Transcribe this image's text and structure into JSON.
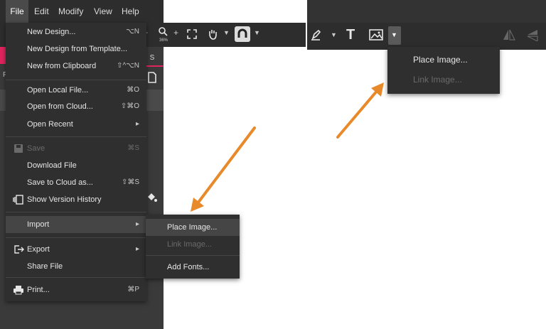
{
  "menubar": {
    "items": [
      "File",
      "Edit",
      "Modify",
      "View",
      "Help"
    ]
  },
  "toolbar": {
    "zoom_label": "36%"
  },
  "file_menu": {
    "items": [
      {
        "label": "New Design...",
        "shortcut": "⌥N",
        "disabled": false
      },
      {
        "label": "New Design from Template...",
        "shortcut": "",
        "disabled": false
      },
      {
        "label": "New from Clipboard",
        "shortcut": "⇧^⌥N",
        "disabled": false
      },
      {
        "label": "Open Local File...",
        "shortcut": "⌘O",
        "disabled": false
      },
      {
        "label": "Open from Cloud...",
        "shortcut": "⇧⌘O",
        "disabled": false
      },
      {
        "label": "Open Recent",
        "shortcut": "",
        "submenu": true,
        "disabled": false
      },
      {
        "label": "Save",
        "shortcut": "⌘S",
        "disabled": true
      },
      {
        "label": "Download File",
        "shortcut": "",
        "disabled": false
      },
      {
        "label": "Save to Cloud as...",
        "shortcut": "⇧⌘S",
        "disabled": false
      },
      {
        "label": "Show Version History",
        "shortcut": "",
        "disabled": false
      },
      {
        "label": "Import",
        "shortcut": "",
        "submenu": true,
        "highlighted": true,
        "disabled": false
      },
      {
        "label": "Export",
        "shortcut": "",
        "submenu": true,
        "disabled": false
      },
      {
        "label": "Share File",
        "shortcut": "",
        "disabled": false
      },
      {
        "label": "Print...",
        "shortcut": "⌘P",
        "disabled": false
      }
    ]
  },
  "import_submenu": {
    "items": [
      {
        "label": "Place Image...",
        "highlighted": true,
        "disabled": false
      },
      {
        "label": "Link Image...",
        "disabled": true
      },
      {
        "label": "Add Fonts...",
        "disabled": false
      }
    ]
  },
  "image_dropdown": {
    "items": [
      {
        "label": "Place Image...",
        "disabled": false
      },
      {
        "label": "Link Image...",
        "disabled": true
      }
    ]
  },
  "left_panel": {
    "tab_letter": "S",
    "row_letter": "F"
  },
  "colors": {
    "accent_pink": "#e0245e",
    "arrow_orange": "#e8892a",
    "menu_bg": "#2f2f2f"
  }
}
